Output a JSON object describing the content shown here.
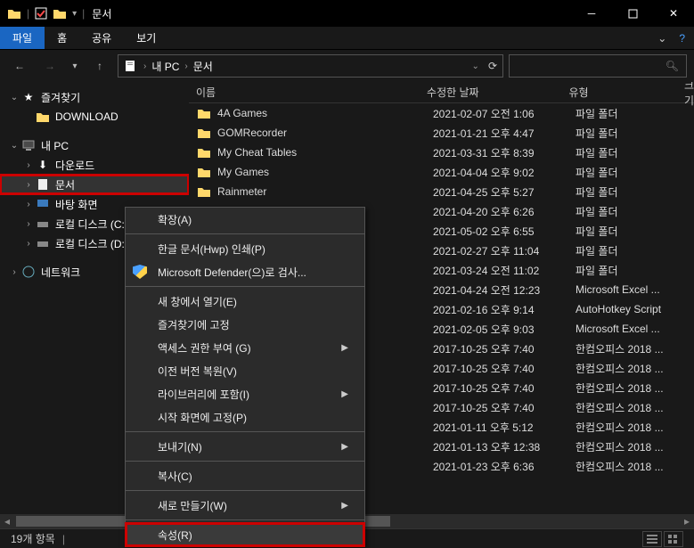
{
  "titlebar": {
    "title": "문서"
  },
  "ribbon": {
    "file": "파일",
    "home": "홈",
    "share": "공유",
    "view": "보기"
  },
  "address": {
    "root": "내 PC",
    "current": "문서"
  },
  "nav": {
    "quick": "즐겨찾기",
    "download": "DOWNLOAD",
    "pc": "내 PC",
    "downloads": "다운로드",
    "documents": "문서",
    "desktop": "바탕 화면",
    "diskC": "로컬 디스크 (C:)",
    "diskD": "로컬 디스크 (D:)",
    "network": "네트워크"
  },
  "columns": {
    "name": "이름",
    "date": "수정한 날짜",
    "type": "유형",
    "size": "크기"
  },
  "rows": [
    {
      "name": "4A Games",
      "date": "2021-02-07 오전 1:06",
      "type": "파일 폴더",
      "folder": true
    },
    {
      "name": "GOMRecorder",
      "date": "2021-01-21 오후 4:47",
      "type": "파일 폴더",
      "folder": true
    },
    {
      "name": "My Cheat Tables",
      "date": "2021-03-31 오후 8:39",
      "type": "파일 폴더",
      "folder": true
    },
    {
      "name": "My Games",
      "date": "2021-04-04 오후 9:02",
      "type": "파일 폴더",
      "folder": true
    },
    {
      "name": "Rainmeter",
      "date": "2021-04-25 오후 5:27",
      "type": "파일 폴더",
      "folder": true
    },
    {
      "name": "",
      "date": "2021-04-20 오후 6:26",
      "type": "파일 폴더",
      "folder": true
    },
    {
      "name": "",
      "date": "2021-05-02 오후 6:55",
      "type": "파일 폴더",
      "folder": true
    },
    {
      "name": "",
      "date": "2021-02-27 오후 11:04",
      "type": "파일 폴더",
      "folder": true
    },
    {
      "name": "",
      "date": "2021-03-24 오전 11:02",
      "type": "파일 폴더",
      "folder": true
    },
    {
      "name": "",
      "date": "2021-04-24 오전 12:23",
      "type": "Microsoft Excel ..."
    },
    {
      "name": "",
      "date": "2021-02-16 오후 9:14",
      "type": "AutoHotkey Script"
    },
    {
      "name": "",
      "date": "2021-02-05 오후 9:03",
      "type": "Microsoft Excel ..."
    },
    {
      "name": "",
      "date": "2017-10-25 오후 7:40",
      "type": "한컴오피스 2018 ..."
    },
    {
      "name": "",
      "date": "2017-10-25 오후 7:40",
      "type": "한컴오피스 2018 ..."
    },
    {
      "name": "",
      "date": "2017-10-25 오후 7:40",
      "type": "한컴오피스 2018 ..."
    },
    {
      "name": "",
      "date": "2017-10-25 오후 7:40",
      "type": "한컴오피스 2018 ..."
    },
    {
      "name": "",
      "date": "2021-01-11 오후 5:12",
      "type": "한컴오피스 2018 ..."
    },
    {
      "name": "",
      "date": "2021-01-13 오후 12:38",
      "type": "한컴오피스 2018 ..."
    },
    {
      "name": "",
      "date": "2021-01-23 오후 6:36",
      "type": "한컴오피스 2018 ..."
    }
  ],
  "context": {
    "expand": "확장(A)",
    "hwpPrint": "한글 문서(Hwp) 인쇄(P)",
    "defender": "Microsoft Defender(으)로 검사...",
    "newWindow": "새 창에서 열기(E)",
    "pinQuick": "즐겨찾기에 고정",
    "accessGrant": "액세스 권한 부여 (G)",
    "restore": "이전 버전 복원(V)",
    "library": "라이브러리에 포함(I)",
    "pinStart": "시작 화면에 고정(P)",
    "sendTo": "보내기(N)",
    "copy": "복사(C)",
    "new": "새로 만들기(W)",
    "props": "속성(R)"
  },
  "status": {
    "count": "19개 항목"
  }
}
